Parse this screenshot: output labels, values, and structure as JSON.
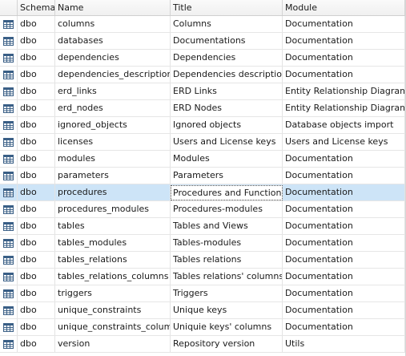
{
  "columns": {
    "schema": "Schema",
    "name": "Name",
    "title": "Title",
    "module": "Module"
  },
  "rows": [
    {
      "schema": "dbo",
      "name": "columns",
      "title": "Columns",
      "module": "Documentation"
    },
    {
      "schema": "dbo",
      "name": "databases",
      "title": "Documentations",
      "module": "Documentation"
    },
    {
      "schema": "dbo",
      "name": "dependencies",
      "title": "Dependencies",
      "module": "Documentation"
    },
    {
      "schema": "dbo",
      "name": "dependencies_descriptions",
      "title": "Dependencies descriptions",
      "module": "Documentation"
    },
    {
      "schema": "dbo",
      "name": "erd_links",
      "title": "ERD Links",
      "module": "Entity Relationship Diagrams"
    },
    {
      "schema": "dbo",
      "name": "erd_nodes",
      "title": "ERD Nodes",
      "module": "Entity Relationship Diagrams"
    },
    {
      "schema": "dbo",
      "name": "ignored_objects",
      "title": "Ignored objects",
      "module": "Database objects import"
    },
    {
      "schema": "dbo",
      "name": "licenses",
      "title": "Users and License keys",
      "module": "Users and License keys"
    },
    {
      "schema": "dbo",
      "name": "modules",
      "title": "Modules",
      "module": "Documentation"
    },
    {
      "schema": "dbo",
      "name": "parameters",
      "title": "Parameters",
      "module": "Documentation"
    },
    {
      "schema": "dbo",
      "name": "procedures",
      "title": "Procedures and Functions",
      "module": "Documentation"
    },
    {
      "schema": "dbo",
      "name": "procedures_modules",
      "title": "Procedures-modules",
      "module": "Documentation"
    },
    {
      "schema": "dbo",
      "name": "tables",
      "title": "Tables and Views",
      "module": "Documentation"
    },
    {
      "schema": "dbo",
      "name": "tables_modules",
      "title": "Tables-modules",
      "module": "Documentation"
    },
    {
      "schema": "dbo",
      "name": "tables_relations",
      "title": "Tables relations",
      "module": "Documentation"
    },
    {
      "schema": "dbo",
      "name": "tables_relations_columns",
      "title": "Tables relations' columns",
      "module": "Documentation"
    },
    {
      "schema": "dbo",
      "name": "triggers",
      "title": "Triggers",
      "module": "Documentation"
    },
    {
      "schema": "dbo",
      "name": "unique_constraints",
      "title": "Unique keys",
      "module": "Documentation"
    },
    {
      "schema": "dbo",
      "name": "unique_constraints_columns",
      "title": "Uniquie keys' columns",
      "module": "Documentation"
    },
    {
      "schema": "dbo",
      "name": "version",
      "title": "Repository version",
      "module": "Utils"
    }
  ],
  "row_icon": "table-icon",
  "selected_row_index": 10,
  "editing_cell": "title",
  "colors": {
    "selected_row": "#cde4f7",
    "grid_line": "#e6e6e6",
    "icon": "#3a5f86"
  }
}
